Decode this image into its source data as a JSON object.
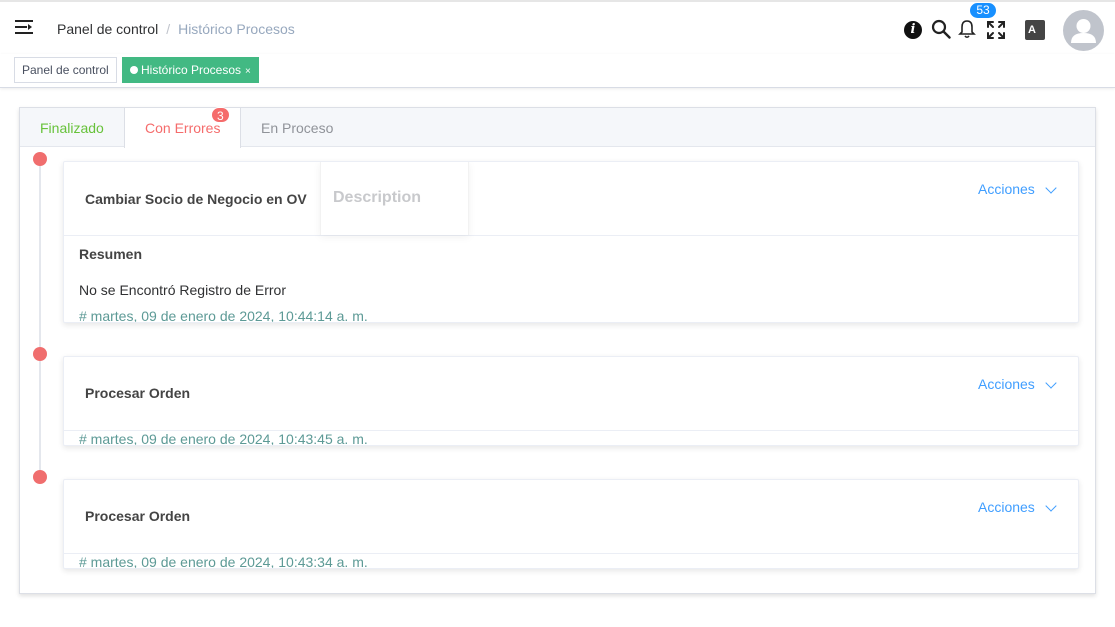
{
  "header": {
    "breadcrumb_home": "Panel de control",
    "breadcrumb_separator": "/",
    "breadcrumb_current": "Histórico Procesos",
    "info_icon": "info-icon",
    "info_glyph": "i",
    "notifications_count": "53",
    "translate_glyph": "A"
  },
  "tags": {
    "home": "Panel de control",
    "active": "Histórico Procesos",
    "active_close": "×"
  },
  "tabs": {
    "finalizado": "Finalizado",
    "con_errores": "Con Errores",
    "con_errores_badge": "3",
    "en_proceso": "En Proceso"
  },
  "timeline": {
    "item1": {
      "title": "Cambiar Socio de Negocio en OV",
      "popover": "Description",
      "actions": "Acciones",
      "summary_title": "Resumen",
      "summary_text": "No se Encontró Registro de Error",
      "date": "# martes, 09 de enero de 2024, 10:44:14 a. m."
    },
    "item2": {
      "title": "Procesar Orden",
      "actions": "Acciones",
      "date": "# martes, 09 de enero de 2024, 10:43:45 a. m."
    },
    "item3": {
      "title": "Procesar Orden",
      "actions": "Acciones",
      "date": "# martes, 09 de enero de 2024, 10:43:34 a. m."
    }
  },
  "colors": {
    "accent_green": "#42b983",
    "link_blue": "#409eff",
    "error_red": "#f56c6c",
    "date_teal": "#5d9a96"
  }
}
